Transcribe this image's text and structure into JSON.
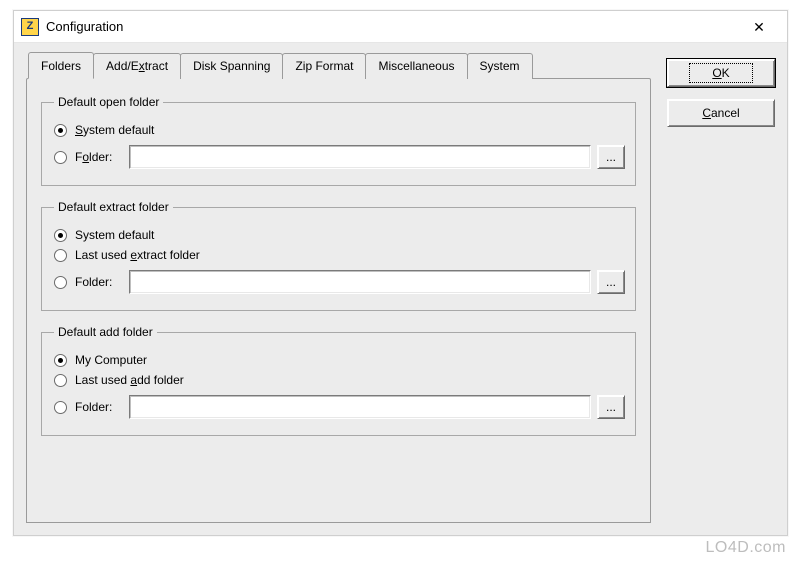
{
  "window": {
    "title": "Configuration",
    "close_glyph": "✕"
  },
  "tabs": [
    {
      "label": "Folders",
      "active": true
    },
    {
      "label_html": "Add/Extract"
    },
    {
      "label": "Disk Spanning"
    },
    {
      "label": "Zip Format"
    },
    {
      "label": "Miscellaneous"
    },
    {
      "label": "System"
    }
  ],
  "groups": {
    "open": {
      "legend": "Default open folder",
      "system_label_pre": "",
      "system_label_u": "S",
      "system_label_post": "ystem default",
      "folder_label_pre": "F",
      "folder_label_u": "o",
      "folder_label_post": "lder:",
      "system_checked": true,
      "folder_checked": false,
      "folder_value": "",
      "browse_label": "..."
    },
    "extract": {
      "legend": "Default extract folder",
      "system_label": "System default",
      "last_label_pre": "Last used ",
      "last_label_u": "e",
      "last_label_post": "xtract folder",
      "folder_label": "Folder:",
      "system_checked": true,
      "last_checked": false,
      "folder_checked": false,
      "folder_value": "",
      "browse_label": "..."
    },
    "add": {
      "legend": "Default add folder",
      "my_label": "My Computer",
      "last_label_pre": "Last used ",
      "last_label_u": "a",
      "last_label_post": "dd folder",
      "folder_label": "Folder:",
      "my_checked": true,
      "last_checked": false,
      "folder_checked": false,
      "folder_value": "",
      "browse_label": "..."
    }
  },
  "buttons": {
    "ok_pre": "",
    "ok_u": "O",
    "ok_post": "K",
    "cancel_pre": "",
    "cancel_u": "C",
    "cancel_post": "ancel"
  },
  "watermark": "LO4D.com"
}
